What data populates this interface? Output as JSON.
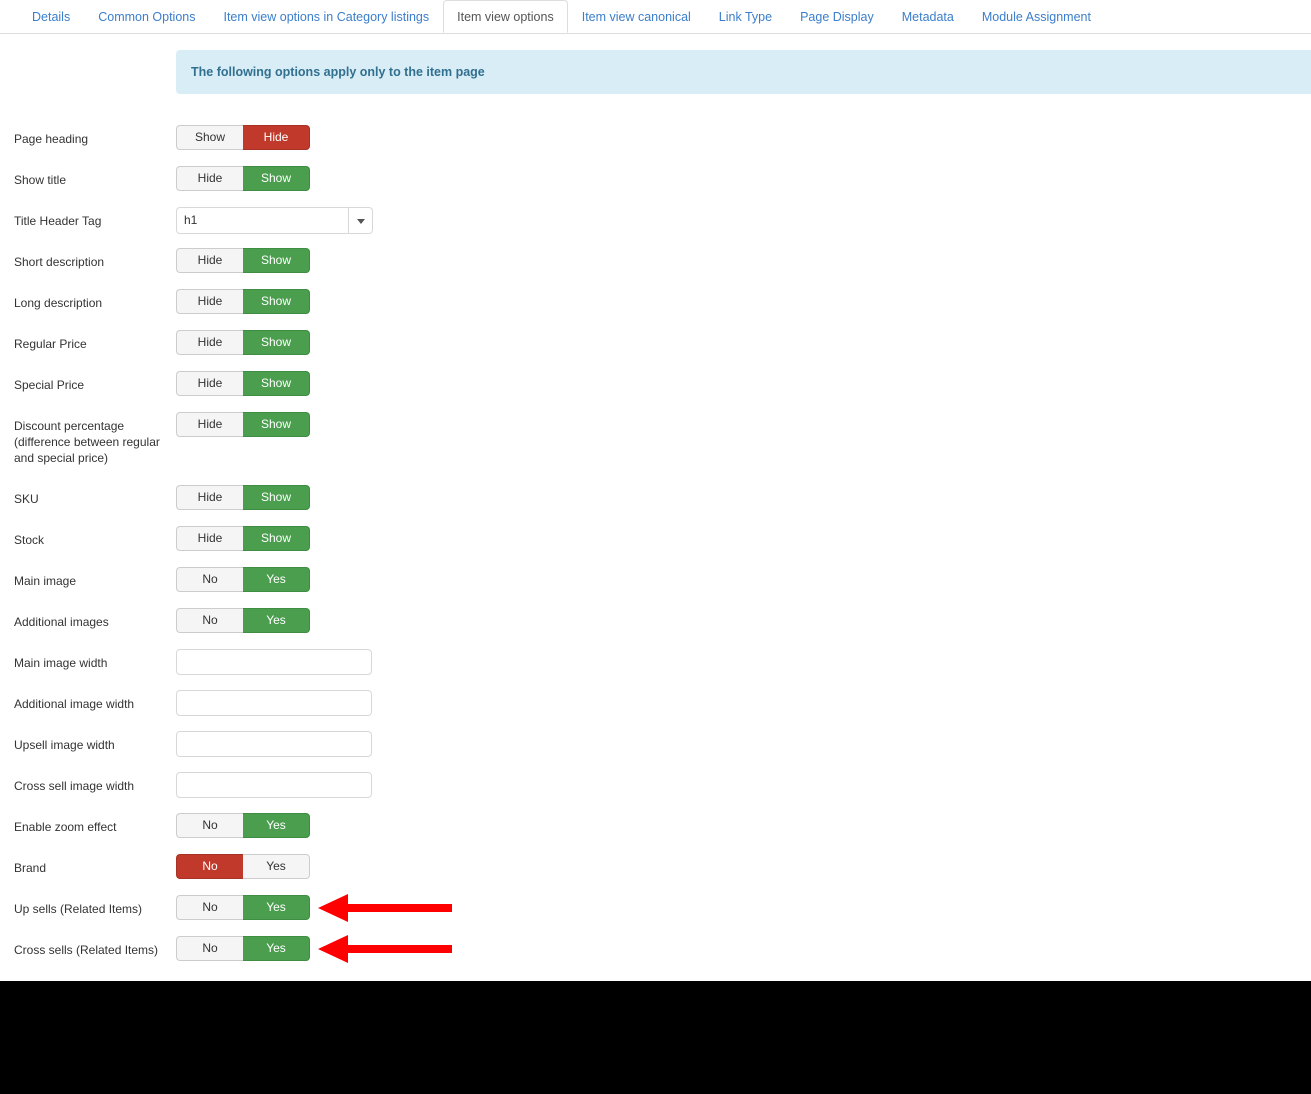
{
  "tabs": [
    {
      "label": "Details",
      "active": false
    },
    {
      "label": "Common Options",
      "active": false
    },
    {
      "label": "Item view options in Category listings",
      "active": false
    },
    {
      "label": "Item view options",
      "active": true
    },
    {
      "label": "Item view canonical",
      "active": false
    },
    {
      "label": "Link Type",
      "active": false
    },
    {
      "label": "Page Display",
      "active": false
    },
    {
      "label": "Metadata",
      "active": false
    },
    {
      "label": "Module Assignment",
      "active": false
    }
  ],
  "notice": {
    "text": "The following options apply only to the item page",
    "background_color": "#d9edf7",
    "text_color": "#31708f"
  },
  "colors": {
    "active_green": "#4a9e4e",
    "active_red": "#c0392b",
    "inactive_gray": "#f5f5f5",
    "arrow_red": "#ff0000",
    "tab_link": "#3b7ecb"
  },
  "rows": [
    {
      "label": "Page heading",
      "type": "toggle",
      "options": [
        "Show",
        "Hide"
      ],
      "selected_index": 1,
      "selected_state": "red",
      "arrow": false
    },
    {
      "label": "Show title",
      "type": "toggle",
      "options": [
        "Hide",
        "Show"
      ],
      "selected_index": 1,
      "selected_state": "green",
      "arrow": false
    },
    {
      "label": "Title Header Tag",
      "type": "select",
      "value": "h1",
      "arrow": false
    },
    {
      "label": "Short description",
      "type": "toggle",
      "options": [
        "Hide",
        "Show"
      ],
      "selected_index": 1,
      "selected_state": "green",
      "arrow": false
    },
    {
      "label": "Long description",
      "type": "toggle",
      "options": [
        "Hide",
        "Show"
      ],
      "selected_index": 1,
      "selected_state": "green",
      "arrow": false
    },
    {
      "label": "Regular Price",
      "type": "toggle",
      "options": [
        "Hide",
        "Show"
      ],
      "selected_index": 1,
      "selected_state": "green",
      "arrow": false
    },
    {
      "label": "Special Price",
      "type": "toggle",
      "options": [
        "Hide",
        "Show"
      ],
      "selected_index": 1,
      "selected_state": "green",
      "arrow": false
    },
    {
      "label": "Discount percentage (difference between regular and special price)",
      "type": "toggle",
      "options": [
        "Hide",
        "Show"
      ],
      "selected_index": 1,
      "selected_state": "green",
      "tall": true,
      "arrow": false
    },
    {
      "label": "SKU",
      "type": "toggle",
      "options": [
        "Hide",
        "Show"
      ],
      "selected_index": 1,
      "selected_state": "green",
      "arrow": false
    },
    {
      "label": "Stock",
      "type": "toggle",
      "options": [
        "Hide",
        "Show"
      ],
      "selected_index": 1,
      "selected_state": "green",
      "arrow": false
    },
    {
      "label": "Main image",
      "type": "toggle",
      "options": [
        "No",
        "Yes"
      ],
      "selected_index": 1,
      "selected_state": "green",
      "arrow": false
    },
    {
      "label": "Additional images",
      "type": "toggle",
      "options": [
        "No",
        "Yes"
      ],
      "selected_index": 1,
      "selected_state": "green",
      "arrow": false
    },
    {
      "label": "Main image width",
      "type": "input",
      "value": "",
      "placeholder": "",
      "arrow": false
    },
    {
      "label": "Additional image width",
      "type": "input",
      "value": "",
      "placeholder": "",
      "arrow": false
    },
    {
      "label": "Upsell image width",
      "type": "input",
      "value": "",
      "placeholder": "",
      "arrow": false
    },
    {
      "label": "Cross sell image width",
      "type": "input",
      "value": "",
      "placeholder": "",
      "arrow": false
    },
    {
      "label": "Enable zoom effect",
      "type": "toggle",
      "options": [
        "No",
        "Yes"
      ],
      "selected_index": 1,
      "selected_state": "green",
      "arrow": false
    },
    {
      "label": "Brand",
      "type": "toggle",
      "options": [
        "No",
        "Yes"
      ],
      "selected_index": 0,
      "selected_state": "red",
      "arrow": false
    },
    {
      "label": "Up sells (Related Items)",
      "type": "toggle",
      "options": [
        "No",
        "Yes"
      ],
      "selected_index": 1,
      "selected_state": "green",
      "arrow": true
    },
    {
      "label": "Cross sells (Related Items)",
      "type": "toggle",
      "options": [
        "No",
        "Yes"
      ],
      "selected_index": 1,
      "selected_state": "green",
      "arrow": true
    }
  ]
}
